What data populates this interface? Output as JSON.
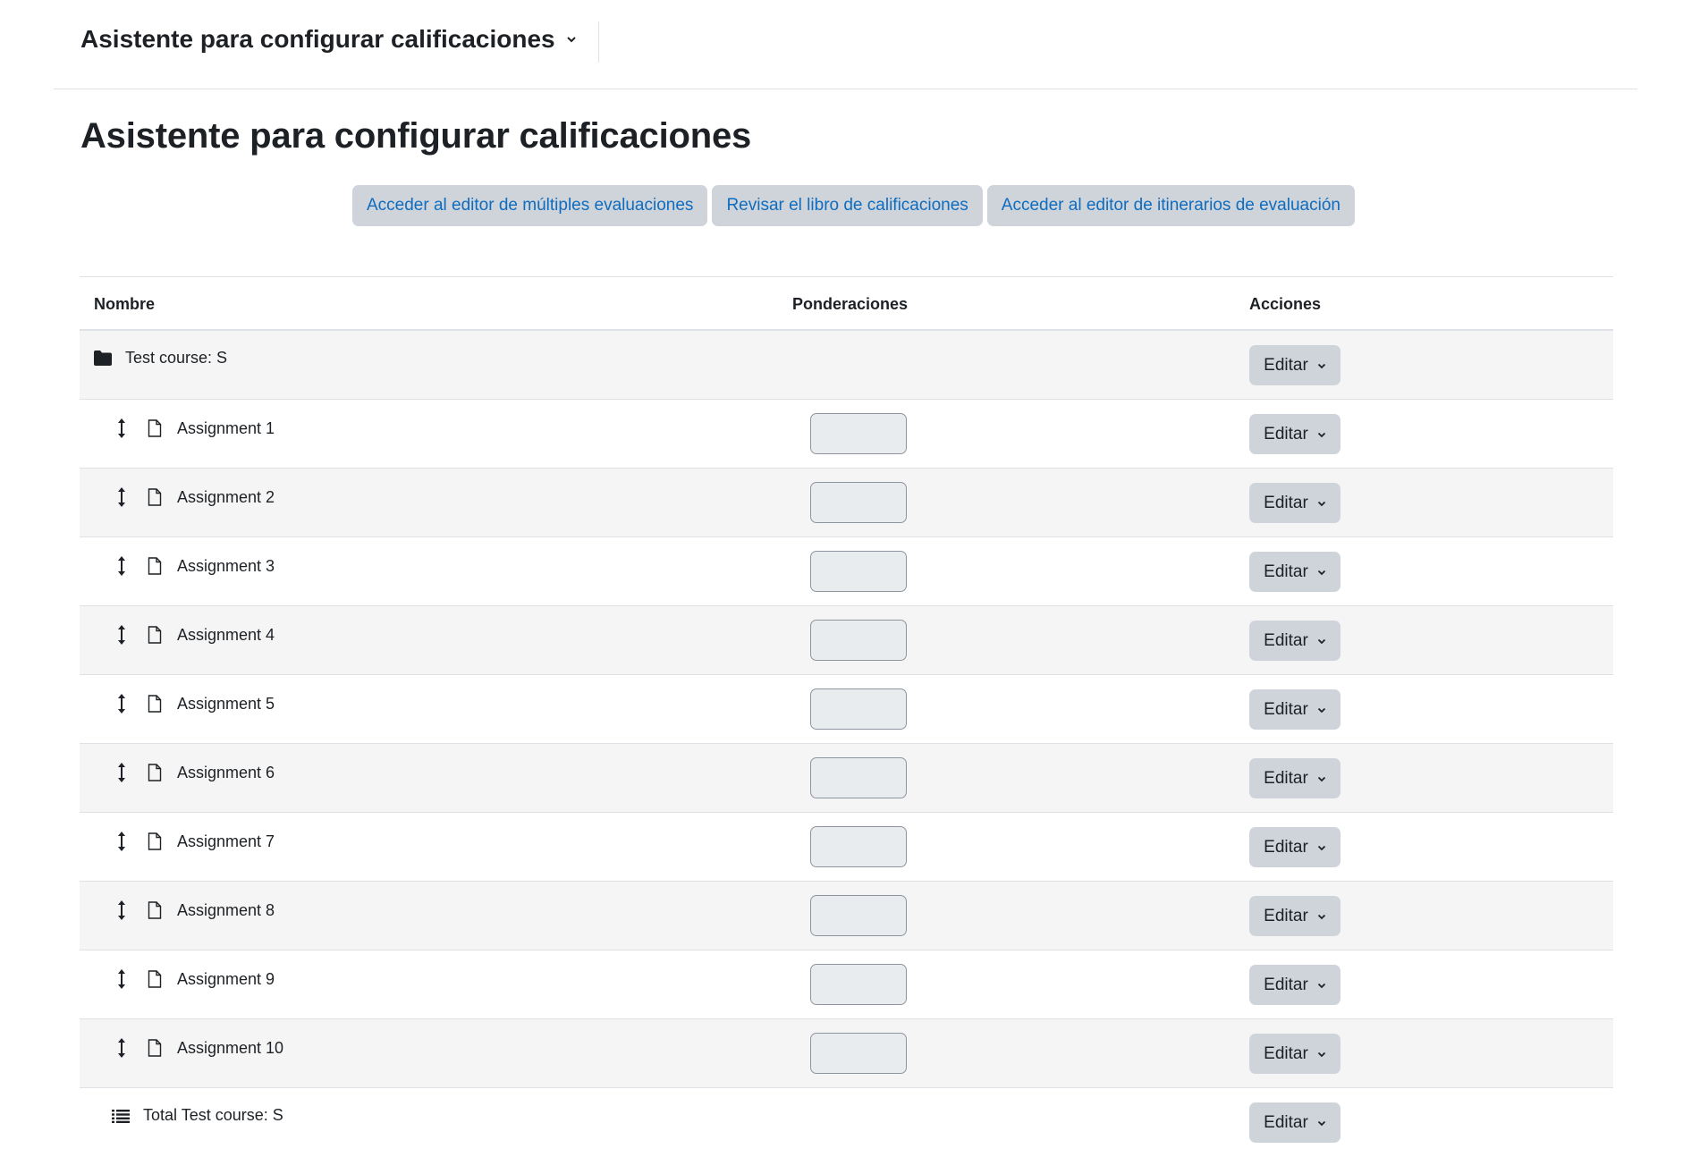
{
  "header": {
    "menu_title": "Asistente para configurar calificaciones"
  },
  "page": {
    "title": "Asistente para configurar calificaciones"
  },
  "actions": {
    "multi_edit": "Acceder al editor de múltiples evaluaciones",
    "review_gradebook": "Revisar el libro de calificaciones",
    "itinerary_editor": "Acceder al editor de itinerarios de evaluación"
  },
  "table": {
    "columns": {
      "name": "Nombre",
      "weights": "Ponderaciones",
      "actions": "Acciones"
    },
    "edit_label": "Editar",
    "course": {
      "name": "Test course: S"
    },
    "items": [
      {
        "name": "Assignment 1",
        "weight": ""
      },
      {
        "name": "Assignment 2",
        "weight": ""
      },
      {
        "name": "Assignment 3",
        "weight": ""
      },
      {
        "name": "Assignment 4",
        "weight": ""
      },
      {
        "name": "Assignment 5",
        "weight": ""
      },
      {
        "name": "Assignment 6",
        "weight": ""
      },
      {
        "name": "Assignment 7",
        "weight": ""
      },
      {
        "name": "Assignment 8",
        "weight": ""
      },
      {
        "name": "Assignment 9",
        "weight": ""
      },
      {
        "name": "Assignment 10",
        "weight": ""
      }
    ],
    "total": {
      "name": "Total Test course: S"
    }
  },
  "colors": {
    "link": "#0f6cbf",
    "button_bg": "#ced4da",
    "input_bg": "#e9ecef",
    "row_alt": "#f5f5f5",
    "border": "#dee2e6"
  },
  "icons": {
    "menu_chevron": "chevron-down-icon",
    "course": "folder-icon",
    "drag": "move-icon",
    "item": "file-icon",
    "total": "list-icon",
    "edit_chevron": "chevron-down-icon"
  }
}
